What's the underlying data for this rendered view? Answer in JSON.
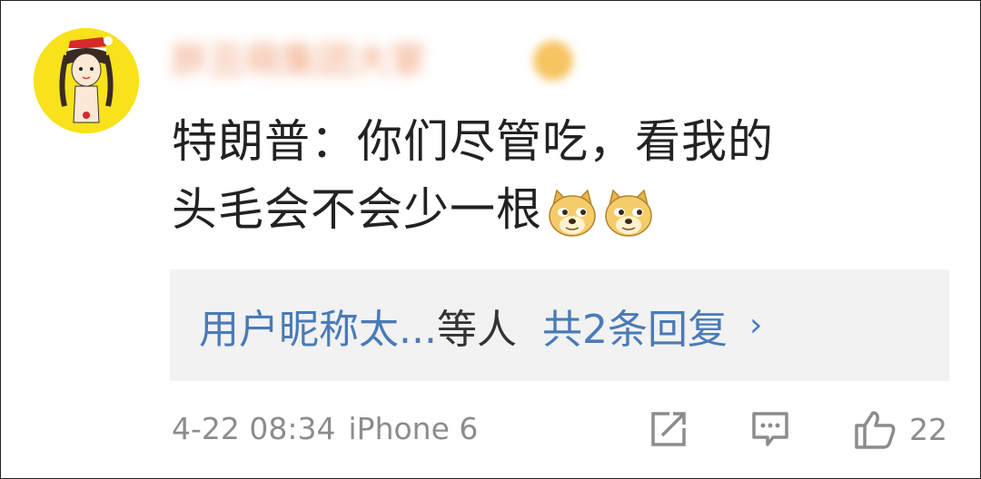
{
  "comment": {
    "author_name": "胖丑萌集团大掌",
    "text_line1": "特朗普：你们尽管吃，看我的",
    "text_line2": "头毛会不会少一根",
    "emojis": [
      "doge-emoji",
      "doge-emoji"
    ]
  },
  "replies": {
    "user": "用户昵称太...",
    "suffix": "等人",
    "count_label": "共2条回复",
    "chevron": "›"
  },
  "meta": {
    "date": "4-22 08:34",
    "device": "iPhone 6"
  },
  "actions": {
    "share_icon": "share-icon",
    "comment_icon": "comment-icon",
    "like_icon": "thumbs-up-icon",
    "like_count": "22"
  },
  "colors": {
    "link": "#4a7bb7",
    "text": "#222222",
    "muted": "#8c8c8c",
    "reply_bg": "#f2f2f2",
    "avatar_bg": "#f7e21c"
  }
}
